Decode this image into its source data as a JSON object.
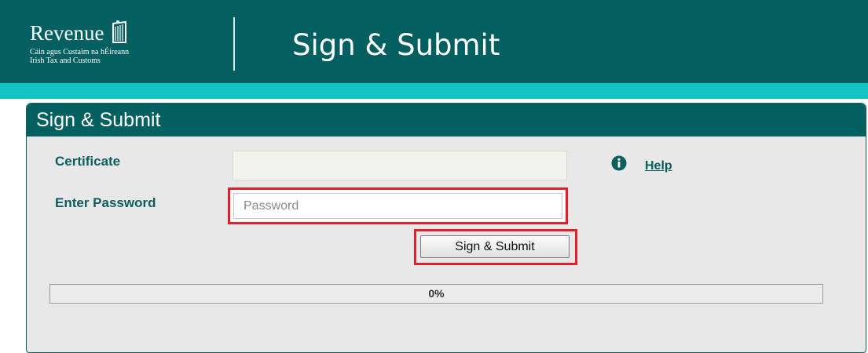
{
  "header": {
    "logo_name": "Revenue",
    "logo_line1": "Cáin agus Custaim na hÉireann",
    "logo_line2": "Irish Tax and Customs",
    "title": "Sign & Submit",
    "icon": "harp-icon"
  },
  "colors": {
    "header_bg": "#046060",
    "accent_stripe": "#12c4c4",
    "highlight_border": "#e0202a",
    "label_text": "#0d5d5d"
  },
  "panel": {
    "title": "Sign & Submit",
    "certificate_label": "Certificate",
    "certificate_value": "",
    "help": {
      "icon": "info-icon",
      "label": "Help"
    },
    "password_label": "Enter Password",
    "password_placeholder": "Password",
    "password_value": "",
    "submit_label": "Sign & Submit",
    "progress": {
      "value": 0,
      "label": "0%"
    }
  }
}
